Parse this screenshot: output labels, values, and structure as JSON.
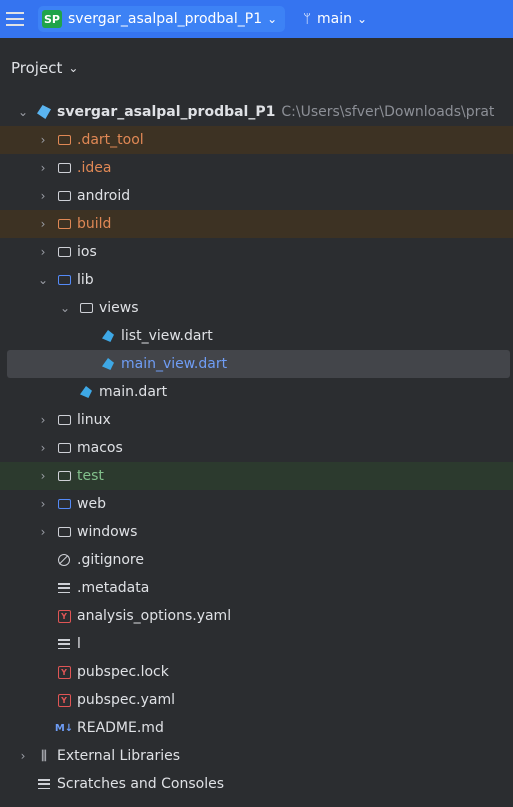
{
  "topbar": {
    "project_badge": "SP",
    "project_name": "svergar_asalpal_prodbal_P1",
    "branch_name": "main"
  },
  "panel": {
    "title": "Project"
  },
  "tree": {
    "root_name": "svergar_asalpal_prodbal_P1",
    "root_path": "C:\\Users\\sfver\\Downloads\\prat",
    "items": [
      {
        "label": ".dart_tool"
      },
      {
        "label": ".idea"
      },
      {
        "label": "android"
      },
      {
        "label": "build"
      },
      {
        "label": "ios"
      },
      {
        "label": "lib"
      },
      {
        "label": "views"
      },
      {
        "label": "list_view.dart"
      },
      {
        "label": "main_view.dart"
      },
      {
        "label": "main.dart"
      },
      {
        "label": "linux"
      },
      {
        "label": "macos"
      },
      {
        "label": "test"
      },
      {
        "label": "web"
      },
      {
        "label": "windows"
      },
      {
        "label": ".gitignore"
      },
      {
        "label": ".metadata"
      },
      {
        "label": "analysis_options.yaml"
      },
      {
        "label": "l"
      },
      {
        "label": "pubspec.lock"
      },
      {
        "label": "pubspec.yaml"
      },
      {
        "label": "README.md"
      },
      {
        "label": "External Libraries"
      },
      {
        "label": "Scratches and Consoles"
      }
    ]
  },
  "icons": {
    "md_badge": "M↓",
    "yaml_badge": "Y"
  },
  "colors": {
    "accent": "#3574f0",
    "excluded_bg": "#3d3223",
    "test_bg": "#2c3a2e",
    "selected_bg": "#43454a"
  }
}
